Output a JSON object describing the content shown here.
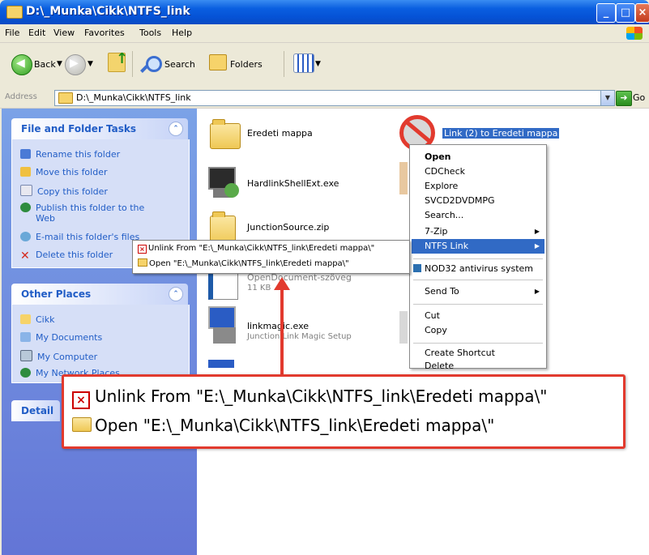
{
  "window": {
    "title": "D:\\_Munka\\Cikk\\NTFS_link"
  },
  "menubar": {
    "items": [
      "File",
      "Edit",
      "View",
      "Favorites",
      "Tools",
      "Help"
    ]
  },
  "toolbar": {
    "back": "Back",
    "search": "Search",
    "folders": "Folders"
  },
  "address": {
    "label": "Address",
    "value": "D:\\_Munka\\Cikk\\NTFS_link",
    "go": "Go"
  },
  "tasks": {
    "title": "File and Folder Tasks",
    "items": [
      "Rename this folder",
      "Move this folder",
      "Copy this folder",
      "Publish this folder to the",
      "Web",
      "E-mail this folder's files",
      "Delete this folder"
    ]
  },
  "places": {
    "title": "Other Places",
    "items": [
      "Cikk",
      "My Documents",
      "My Computer",
      "My Network Places"
    ]
  },
  "details": {
    "title": "Detail"
  },
  "files": {
    "f1": "Eredeti mappa",
    "f2": "Link (2) to Eredeti mappa",
    "f3": "HardlinkShellExt.exe",
    "f4": "JunctionSource.zip",
    "f5": "OpenDocument-szöveg",
    "f5sub": "11 KB",
    "f6": "linkmagic.exe",
    "f6sub": "Junction Link Magic Setup"
  },
  "context_menu": {
    "open": "Open",
    "cdcheck": "CDCheck",
    "explore": "Explore",
    "svcd": "SVCD2DVDMPG",
    "search": "Search...",
    "zip": "7-Zip",
    "ntfs": "NTFS Link",
    "nod": "NOD32 antivirus system",
    "sendto": "Send To",
    "cut": "Cut",
    "copy": "Copy",
    "shortcut": "Create Shortcut",
    "delete": "Delete"
  },
  "submenu": {
    "unlink": "Unlink From \"E:\\_Munka\\Cikk\\NTFS_link\\Eredeti mappa\\\"",
    "open": "Open \"E:\\_Munka\\Cikk\\NTFS_link\\Eredeti mappa\\\""
  },
  "colors": {
    "accent": "#e23a2e",
    "highlight": "#316ac5",
    "link": "#215dc6"
  }
}
